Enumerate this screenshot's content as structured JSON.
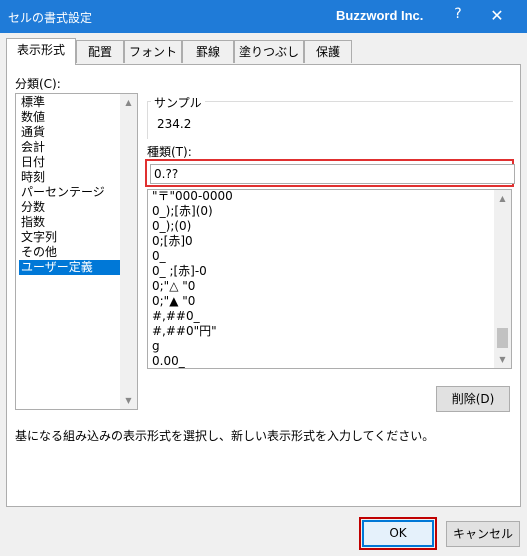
{
  "window": {
    "title": "セルの書式設定",
    "brand": "Buzzword Inc.",
    "help_label": "?",
    "close_label": "✕"
  },
  "tabs": [
    {
      "label": "表示形式",
      "active": true
    },
    {
      "label": "配置"
    },
    {
      "label": "フォント"
    },
    {
      "label": "罫線"
    },
    {
      "label": "塗りつぶし"
    },
    {
      "label": "保護"
    }
  ],
  "category": {
    "label": "分類(C):",
    "items": [
      "標準",
      "数値",
      "通貨",
      "会計",
      "日付",
      "時刻",
      "パーセンテージ",
      "分数",
      "指数",
      "文字列",
      "その他",
      "ユーザー定義"
    ],
    "selected": "ユーザー定義"
  },
  "sample": {
    "label": "サンプル",
    "value": "234.2"
  },
  "type": {
    "label": "種類(T):",
    "value": "0.??"
  },
  "formats": [
    "\"〒\"000-0000",
    "0_);[赤](0)",
    "0_);(0)",
    "0;[赤]0",
    "0_",
    "0_ ;[赤]-0",
    "0;\"△ \"0",
    "0;\"▲ \"0",
    "#,##0_",
    "#,##0\"円\"",
    "g",
    "0.00_"
  ],
  "buttons": {
    "delete": "削除(D)",
    "ok": "OK",
    "cancel": "キャンセル"
  },
  "description": "基になる組み込みの表示形式を選択し、新しい表示形式を入力してください。",
  "colors": {
    "titlebar": "#1f7bd8",
    "selection": "#0078d7",
    "highlight_border": "#e03030"
  }
}
